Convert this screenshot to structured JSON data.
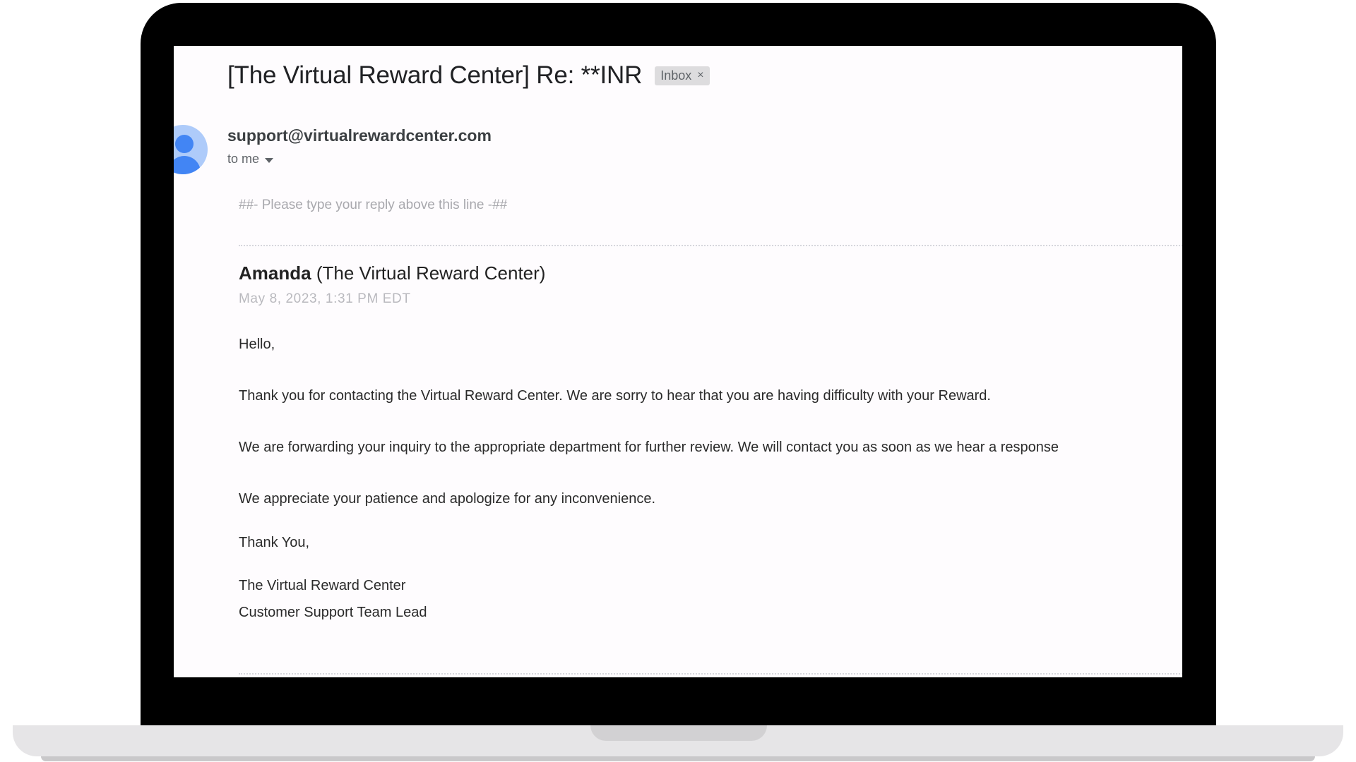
{
  "email": {
    "subject": "[The Virtual Reward Center] Re: **INR",
    "label": "Inbox",
    "label_close": "×",
    "sender": "support@virtualrewardcenter.com",
    "recipient": "to me",
    "reply_marker": "##- Please type your reply above this line -##",
    "agent_name": "Amanda",
    "agent_org": "(The Virtual Reward Center)",
    "timestamp": "May 8, 2023, 1:31 PM EDT",
    "greeting": "Hello,",
    "paragraph_1": "Thank you for contacting the Virtual Reward Center. We are sorry to hear that you are having difficulty with your Reward.",
    "paragraph_2": "We are forwarding your inquiry to the appropriate department for further review. We will contact you as soon as we hear a response",
    "paragraph_3": "We appreciate your patience and apologize for any inconvenience.",
    "closing": "Thank You,",
    "signature_line_1": "The Virtual Reward Center",
    "signature_line_2": "Customer Support Team Lead"
  },
  "icons": {
    "avatar": "person-avatar-icon",
    "recipient_toggle": "caret-down-icon",
    "label_remove": "close-icon"
  },
  "colors": {
    "avatar_background": "#aecbfa",
    "avatar_figure": "#4285f4",
    "label_chip": "#dddcde",
    "screen_background": "#fefcfe"
  }
}
